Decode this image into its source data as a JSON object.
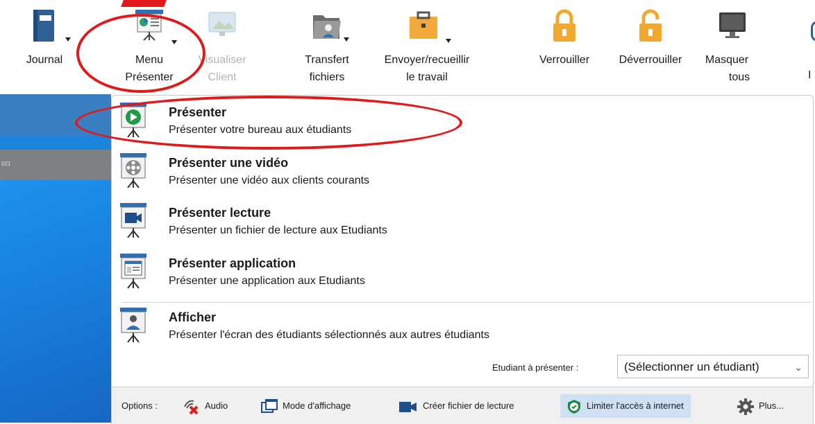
{
  "toolbar": {
    "journal": {
      "line1": "Journal",
      "line2": ""
    },
    "menu_presenter": {
      "line1": "Menu",
      "line2": "Présenter"
    },
    "visualiser_client": {
      "line1": "Visualiser",
      "line2": "Client"
    },
    "transfert": {
      "line1": "Transfert",
      "line2": "fichiers"
    },
    "envoyer": {
      "line1": "Envoyer/recueillir",
      "line2": "le travail"
    },
    "verrouiller": {
      "line1": "Verrouiller",
      "line2": ""
    },
    "deverrouiller": {
      "line1": "Déverrouiller",
      "line2": ""
    },
    "masquer": {
      "line1": "Masquer",
      "line2": "tous"
    },
    "partial_label": "I"
  },
  "leftpane": {
    "strip_text": "021"
  },
  "menu": {
    "items": [
      {
        "title": "Présenter",
        "desc": "Présenter votre bureau aux étudiants",
        "icon": "play-presentation-icon"
      },
      {
        "title": "Présenter une vidéo",
        "desc": "Présenter une vidéo aux clients courants",
        "icon": "film-reel-icon"
      },
      {
        "title": "Présenter lecture",
        "desc": "Présenter un fichier de lecture aux Etudiants",
        "icon": "video-camera-icon"
      },
      {
        "title": "Présenter application",
        "desc": "Présenter une application aux Etudiants",
        "icon": "application-window-icon"
      },
      {
        "title": "Afficher",
        "desc": "Présenter l'écran des étudiants sélectionnés aux autres étudiants",
        "icon": "student-screen-icon"
      }
    ],
    "student_label": "Etudiant à présenter :",
    "student_select": "(Sélectionner un étudiant)"
  },
  "options": {
    "label": "Options :",
    "audio": "Audio",
    "mode": "Mode d'affichage",
    "creer": "Créer fichier de lecture",
    "limiter": "Limiter l'accès à internet",
    "plus": "Plus..."
  },
  "colors": {
    "accent": "#1b84dd",
    "annotation": "#e01a1a",
    "highlight": "#cfe0f3"
  }
}
